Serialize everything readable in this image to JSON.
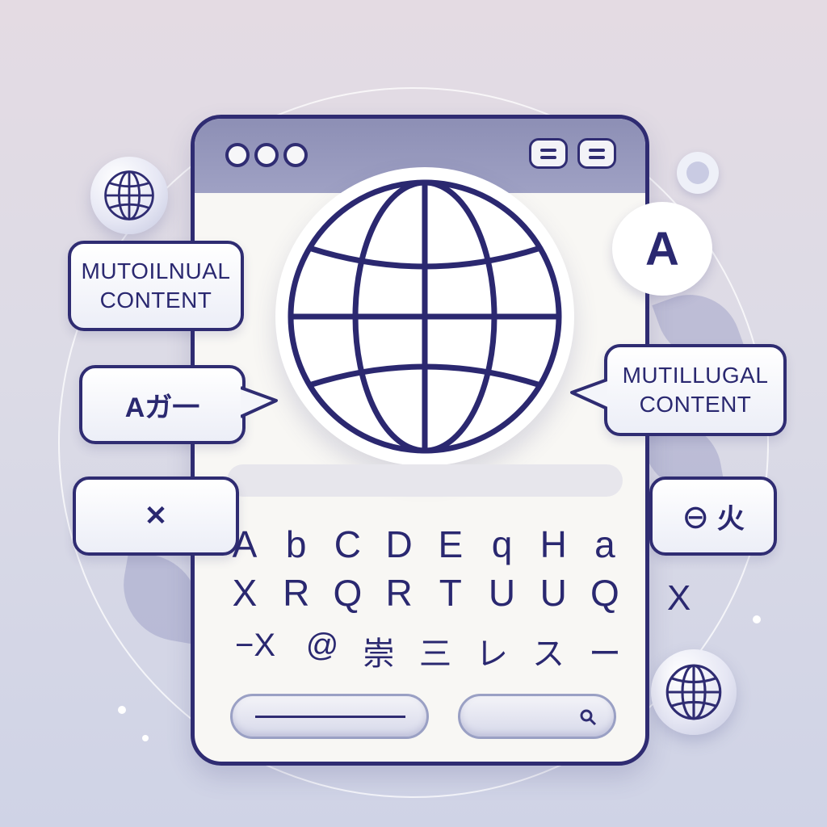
{
  "bubbles": {
    "left_top": {
      "line1": "MUTOILNUAL",
      "line2": "CONTENT"
    },
    "right_mid": {
      "line1": "MUTILLUGAL",
      "line2": "CONTENT"
    },
    "left_mid": {
      "text": "Aガ一"
    },
    "left_low": {
      "text": "✕"
    },
    "right_low": {
      "text": "⊖ 火"
    },
    "speech_letter": "A",
    "x_mark": "X"
  },
  "keyboard": {
    "row1": [
      "A",
      "b",
      "C",
      "D",
      "E",
      "q",
      "H",
      "a"
    ],
    "row2": [
      "X",
      "R",
      "Q",
      "R",
      "T",
      "U",
      "U",
      "Q"
    ],
    "row3": [
      "−X",
      "@",
      "崇",
      "三",
      "レ",
      "ス",
      "ー"
    ]
  },
  "colors": {
    "accent": "#2f2c72",
    "titlebar": "#9fa1c4",
    "background": "#dcdbe6"
  },
  "icons": [
    "globe-icon",
    "search-icon",
    "menu-icon"
  ]
}
